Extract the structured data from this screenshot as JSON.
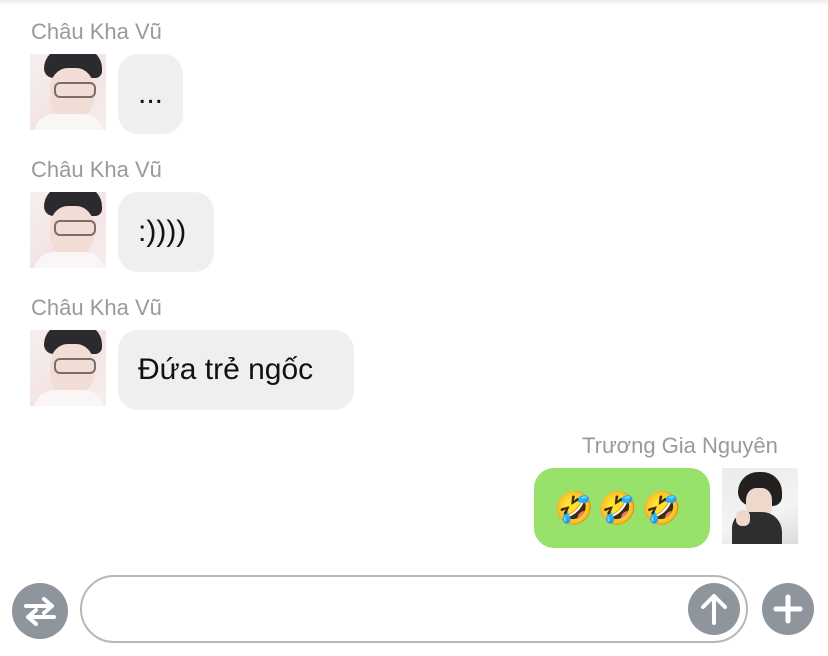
{
  "conversation": {
    "messages": [
      {
        "sender": "Châu Kha Vũ",
        "direction": "incoming",
        "text": "..."
      },
      {
        "sender": "Châu Kha Vũ",
        "direction": "incoming",
        "text": ":))))"
      },
      {
        "sender": "Châu Kha Vũ",
        "direction": "incoming",
        "text": "Đứa trẻ ngốc"
      },
      {
        "sender": "Trương Gia Nguyên",
        "direction": "outgoing",
        "text": "🤣🤣🤣"
      }
    ]
  },
  "composer": {
    "input_value": "",
    "toggle_icon": "swap-arrows-icon",
    "send_icon": "arrow-up-icon",
    "add_icon": "plus-icon"
  },
  "colors": {
    "incoming_bubble": "#efefef",
    "outgoing_bubble": "#98e26c",
    "sender_name": "#9a9a9a",
    "control_gray": "#8f959c"
  }
}
